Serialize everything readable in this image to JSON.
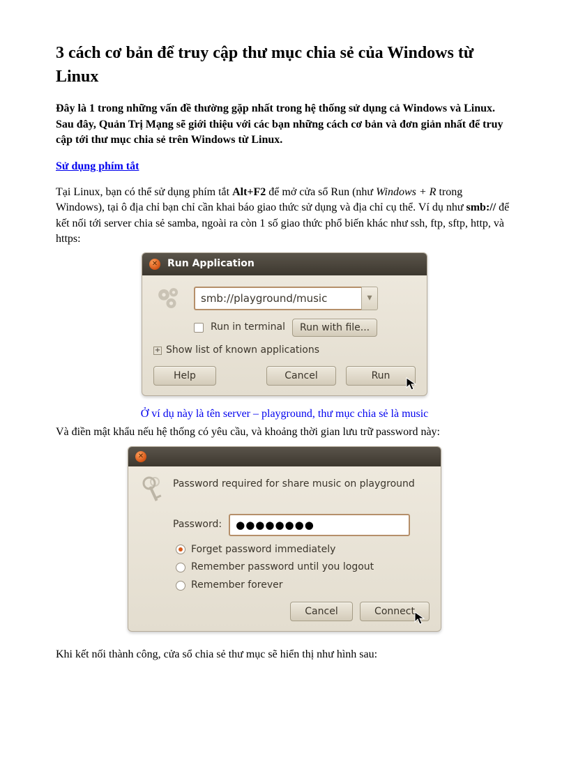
{
  "title": "3 cách cơ bản để truy cập thư mục chia sẻ của Windows từ Linux",
  "intro": "Đây là 1 trong những vấn đề thường gặp nhất trong hệ thống sử dụng cả Windows và Linux. Sau đây, Quản Trị Mạng sẽ giới thiệu với các bạn những cách cơ bản và đơn giản nhất để truy cập tới thư mục chia sẻ trên Windows từ Linux.",
  "section1_heading": "Sử dụng phím tắt",
  "p1_a": "Tại Linux, bạn có thể sử dụng phím tắt ",
  "p1_kbd": "Alt+F2",
  "p1_b": " để mở cửa sổ Run (như ",
  "p1_em": "Windows + R",
  "p1_c": " trong Windows), tại ô địa chỉ bạn chỉ cần khai báo giao thức sử dụng và địa chỉ cụ thể. Ví dụ như ",
  "p1_smb": "smb://",
  "p1_d": " để kết nối tới server chia sẻ samba, ngoài ra còn 1 số giao thức phổ biến khác như ssh, ftp, sftp, http, và https:",
  "run_dialog": {
    "title": "Run Application",
    "url_value": "smb://playground/music",
    "run_in_terminal": "Run in terminal",
    "run_with_file": "Run with file...",
    "expander": "Show list of known applications",
    "help": "Help",
    "cancel": "Cancel",
    "run": "Run"
  },
  "caption1": "Ở ví dụ này là tên server – playground, thư mục chia sẻ là music",
  "p2": "Và điền mật khẩu nếu hệ thống có yêu cầu, và khoảng thời gian lưu trữ password này:",
  "pw_dialog": {
    "heading": "Password required for share music on playground",
    "password_label": "Password:",
    "password_value": "●●●●●●●●",
    "opt1": "Forget password immediately",
    "opt2": "Remember password until you logout",
    "opt3": "Remember forever",
    "cancel": "Cancel",
    "connect": "Connect"
  },
  "p3": "Khi kết nối thành công, cửa sổ chia sẻ thư mục sẽ hiển thị như hình sau:"
}
